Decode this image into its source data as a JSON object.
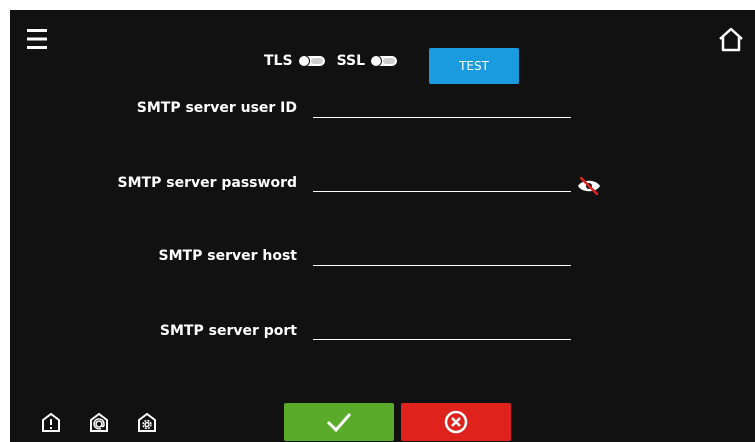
{
  "header": {
    "menu_icon": "hamburger-menu-icon",
    "home_icon": "home-icon"
  },
  "security": {
    "tls_label": "TLS",
    "tls_enabled": false,
    "ssl_label": "SSL",
    "ssl_enabled": false,
    "test_label": "TEST"
  },
  "fields": {
    "user_id_label": "SMTP server user ID",
    "user_id_value": "",
    "password_label": "SMTP server password",
    "password_value": "",
    "password_visibility_icon": "eye-slash-icon",
    "host_label": "SMTP server host",
    "host_value": "",
    "port_label": "SMTP server port",
    "port_value": ""
  },
  "footer": {
    "icons": [
      "alarm-icon",
      "email-icon",
      "settings-icon"
    ],
    "confirm_icon": "checkmark-icon",
    "cancel_icon": "cancel-icon"
  },
  "colors": {
    "background": "#111111",
    "test_button": "#1a9be0",
    "confirm": "#5aab29",
    "cancel": "#e0221d",
    "eye_slash": "#e0221d"
  }
}
